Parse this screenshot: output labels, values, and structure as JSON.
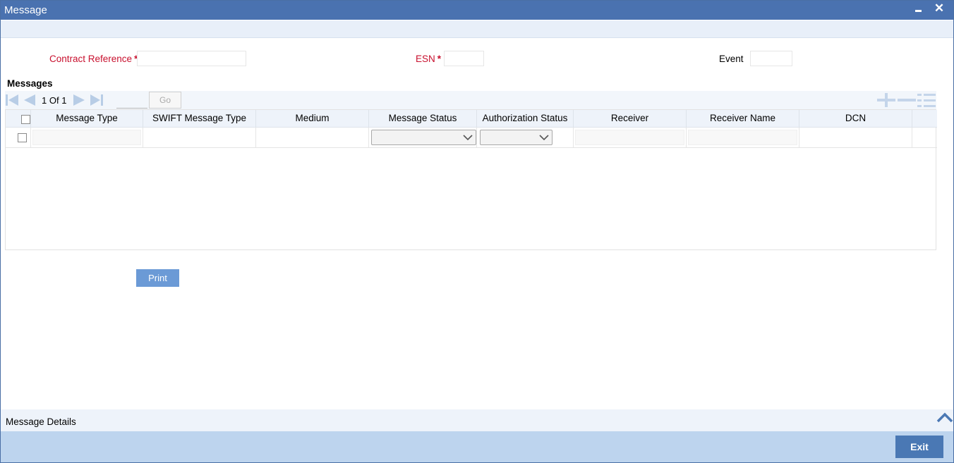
{
  "window": {
    "title": "Message",
    "minimize_icon": "minimize-icon",
    "close_icon": "close-icon",
    "close_glyph": "✕"
  },
  "form": {
    "contract_reference": {
      "label": "Contract Reference",
      "required": "*",
      "value": ""
    },
    "esn": {
      "label": "ESN",
      "required": "*",
      "value": ""
    },
    "event": {
      "label": "Event",
      "value": ""
    }
  },
  "messages": {
    "title": "Messages",
    "pager": {
      "current": "1",
      "of_label": "Of",
      "total": "1",
      "go_label": "Go",
      "page_input": ""
    },
    "columns": [
      "Message Type",
      "SWIFT Message Type",
      "Medium",
      "Message Status",
      "Authorization Status",
      "Receiver",
      "Receiver Name",
      "DCN"
    ],
    "rows": [
      {
        "message_type": "",
        "swift_message_type": "",
        "medium": "",
        "message_status": "",
        "authorization_status": "",
        "receiver": "",
        "receiver_name": "",
        "dcn": ""
      }
    ],
    "toolbar_icons": [
      "add-row-icon",
      "delete-row-icon",
      "single-view-icon"
    ]
  },
  "actions": {
    "print_label": "Print",
    "exit_label": "Exit"
  },
  "details": {
    "label": "Message Details"
  },
  "colors": {
    "titlebar": "#4a72b0",
    "accent": "#4a78b4",
    "footer": "#bdd4ee",
    "required": "#c8102e"
  }
}
